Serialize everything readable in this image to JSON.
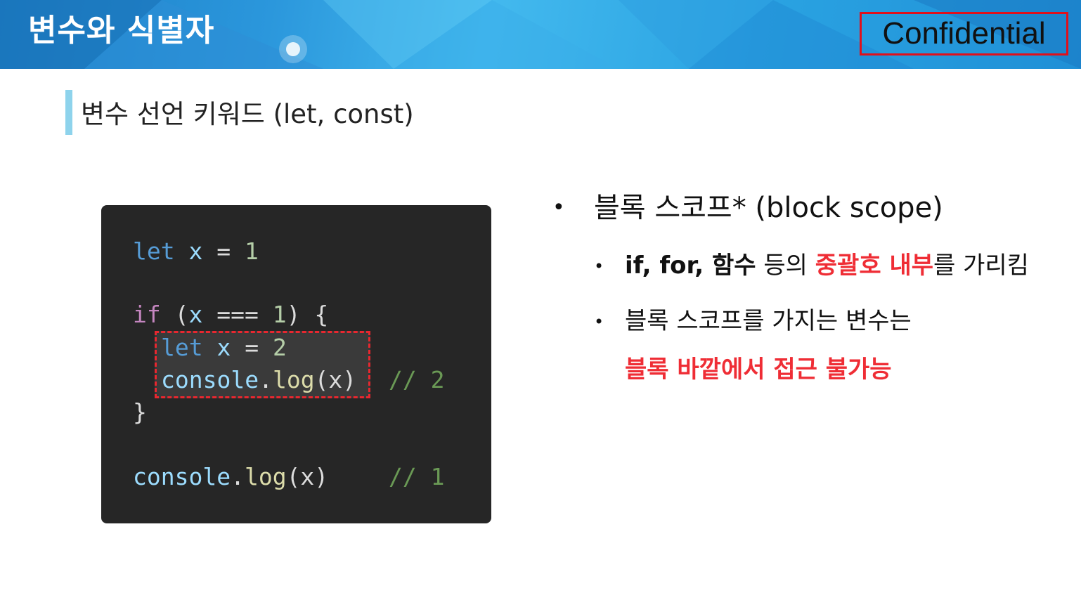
{
  "header": {
    "title": "변수와 식별자",
    "badge": "Confidential"
  },
  "section": {
    "heading": "변수 선언 키워드 (let, const)"
  },
  "code": {
    "line1": {
      "kw": "let",
      "var": "x",
      "op": "=",
      "num": "1"
    },
    "line3": {
      "kw": "if",
      "open": "(",
      "var": "x",
      "op": "===",
      "num": "1",
      "close": ")",
      "brace": "{"
    },
    "line4": {
      "kw": "let",
      "var": "x",
      "op": "=",
      "num": "2"
    },
    "line5": {
      "obj": "console",
      "dot": ".",
      "fn": "log",
      "args": "(x)",
      "comment": "// 2"
    },
    "line6": {
      "brace": "}"
    },
    "line8": {
      "obj": "console",
      "dot": ".",
      "fn": "log",
      "args": "(x)",
      "comment": "// 1"
    }
  },
  "bullets": {
    "main": {
      "dot": "•",
      "text": "블록 스코프* (block scope)"
    },
    "sub1": {
      "dot": "•",
      "bold_part": "if, for, 함수",
      "plain_part": " 등의 ",
      "red_part": "중괄호 내부",
      "tail": "를 가리킴"
    },
    "sub2": {
      "dot": "•",
      "text": "블록 스코프를 가지는 변수는",
      "red_line": "블록 바깥에서 접근 불가능"
    }
  },
  "colors": {
    "accent_red": "#ef2d35",
    "header_blue": "#2b97dc",
    "section_bar": "#8ed3ec",
    "code_bg": "#262626"
  }
}
